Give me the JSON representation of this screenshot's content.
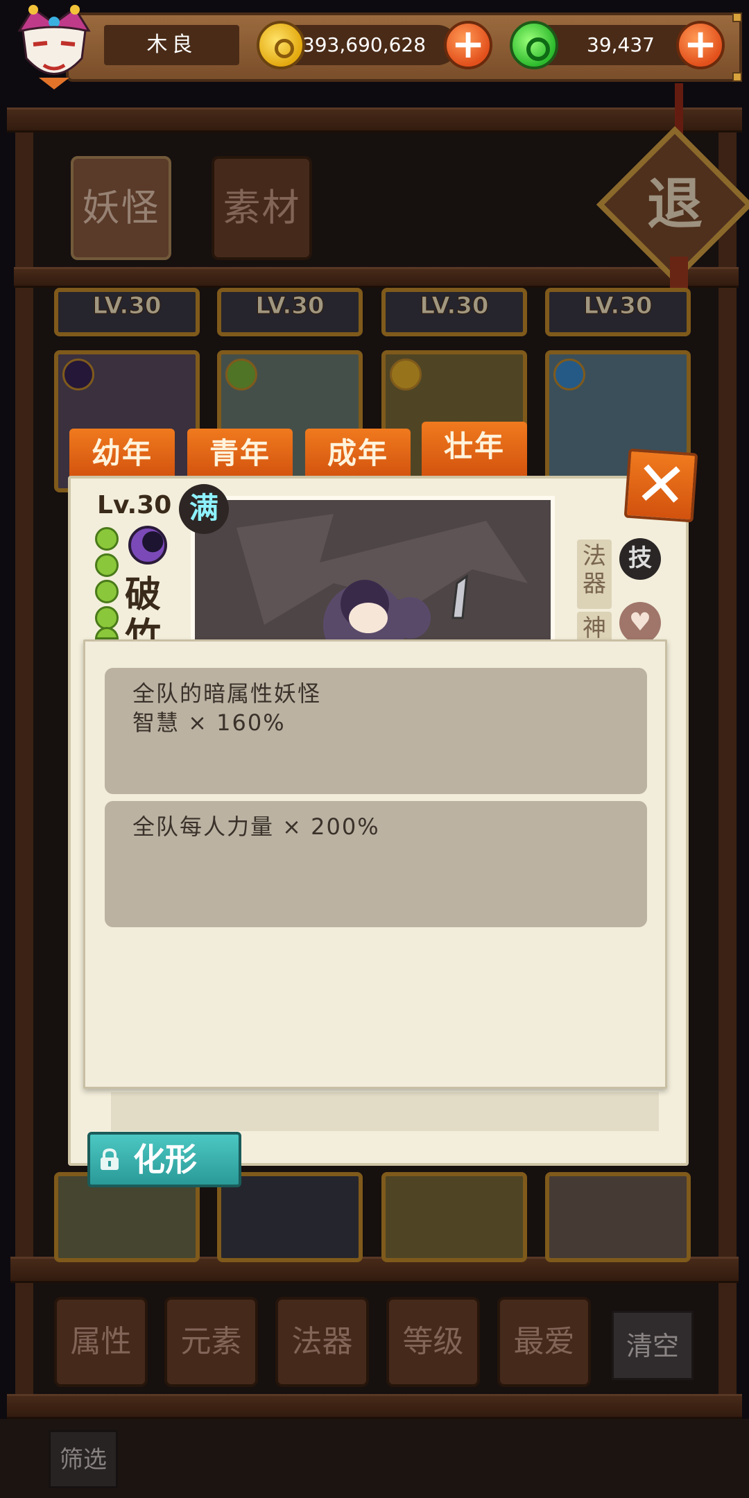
{
  "header": {
    "player_name": "木良",
    "gold_amount": "393,690,628",
    "gem_amount": "39,437",
    "gold_plus": "+",
    "gem_plus": "+"
  },
  "category_tabs": [
    {
      "label": "妖怪"
    },
    {
      "label": "素材"
    }
  ],
  "exit_label": "退",
  "card_levels": [
    "LV.30",
    "LV.30",
    "LV.30",
    "LV.30"
  ],
  "age_tabs": [
    {
      "label": "幼年"
    },
    {
      "label": "青年"
    },
    {
      "label": "成年"
    },
    {
      "label": "壮年"
    }
  ],
  "detail": {
    "level": "Lv.30",
    "full_badge": "满",
    "name": "破竹",
    "side_tag_artifact": "法器",
    "side_tag_divine": "神",
    "skill_icon": "技",
    "heart_icon": "♥",
    "close": "✕",
    "element_icon": "dark-moon-icon",
    "star_count": 5
  },
  "tooltip": {
    "skill_1_line_1": "全队的暗属性妖怪",
    "skill_1_line_2": "智慧 × 160%",
    "skill_2_line_1": "全队每人力量 × 200%"
  },
  "transform_button": "化形",
  "filters": [
    {
      "label": "属性"
    },
    {
      "label": "元素"
    },
    {
      "label": "法器"
    },
    {
      "label": "等级"
    },
    {
      "label": "最爱"
    }
  ],
  "clear_button": "清空",
  "screen_button": "筛选",
  "colors": {
    "accent_orange": "#e2601a",
    "teal_button": "#2a9a98",
    "gold": "#e3a90f",
    "gem_green": "#2cba2c"
  }
}
